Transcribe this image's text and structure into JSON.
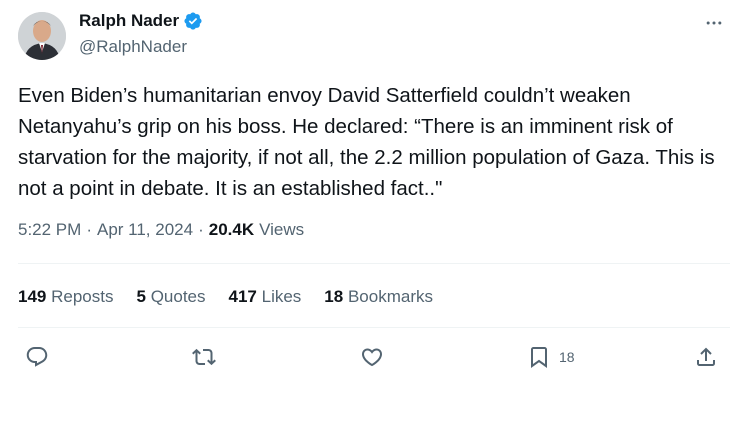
{
  "author": {
    "name": "Ralph Nader",
    "handle": "@RalphNader"
  },
  "tweet": {
    "text": "Even Biden’s humanitarian envoy David Satterfield couldn’t weaken Netanyahu’s grip on his boss. He declared: “There is an imminent risk of starvation for the majority, if not all, the 2.2 million population of Gaza. This is not a point in debate. It is an established fact..\"",
    "time": "5:22 PM",
    "sep1": "·",
    "date": "Apr 11, 2024",
    "sep2": "·",
    "views_count": "20.4K",
    "views_label": "Views"
  },
  "stats": {
    "reposts_count": "149",
    "reposts_label": "Reposts",
    "quotes_count": "5",
    "quotes_label": "Quotes",
    "likes_count": "417",
    "likes_label": "Likes",
    "bookmarks_count": "18",
    "bookmarks_label": "Bookmarks"
  },
  "actions": {
    "bookmark_count": "18",
    "icons": [
      "reply-icon",
      "repost-icon",
      "like-icon",
      "bookmark-icon",
      "share-icon"
    ]
  },
  "colors": {
    "text": "#0f1419",
    "secondary": "#536471",
    "verified": "#1d9bf0",
    "divider": "#eff3f4"
  }
}
